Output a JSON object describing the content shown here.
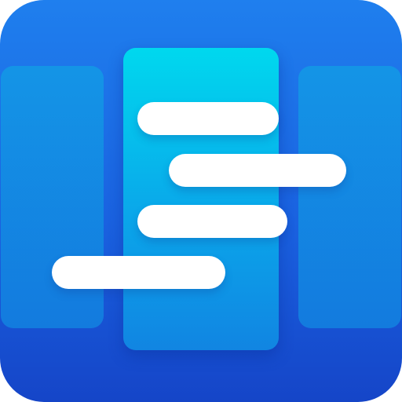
{
  "icon": {
    "semantic_name": "kanban-board-icon",
    "colors": {
      "background_top": "#1f7fee",
      "background_bottom": "#1545c8",
      "side_column": "#137ddf",
      "center_column_top": "#00d8ee",
      "center_column_bottom": "#1185e2",
      "bar": "#ffffff"
    },
    "columns": [
      "left",
      "center",
      "right"
    ],
    "bar_count": 4
  }
}
